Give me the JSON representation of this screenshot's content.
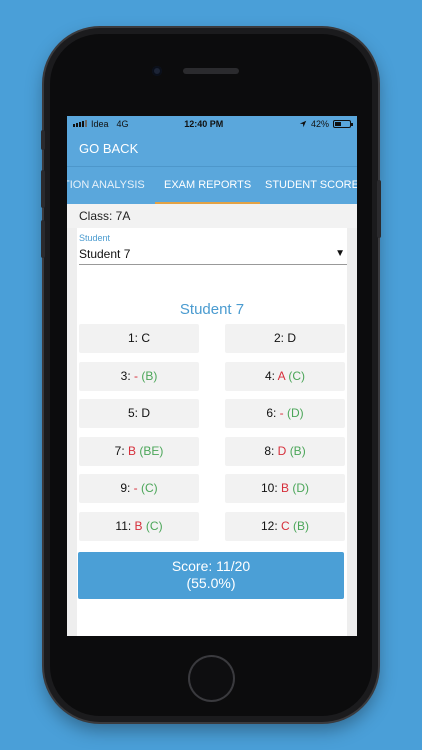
{
  "status_bar": {
    "carrier": "Idea",
    "network": "4G",
    "time": "12:40 PM",
    "battery": "42%",
    "battery_level": 0.42
  },
  "nav": {
    "back_label": "GO BACK"
  },
  "tabs": [
    {
      "label": "TION ANALYSIS"
    },
    {
      "label": "EXAM REPORTS"
    },
    {
      "label": "STUDENT SCORES"
    }
  ],
  "class_label": "Class: 7A",
  "student_field": {
    "label": "Student",
    "value": "Student 7"
  },
  "student_heading": "Student 7",
  "answers": [
    {
      "num": "1:",
      "given": "C",
      "correct": ""
    },
    {
      "num": "2:",
      "given": "D",
      "correct": ""
    },
    {
      "num": "3:",
      "given": "-",
      "correct": "(B)"
    },
    {
      "num": "4:",
      "given": "A",
      "correct": "(C)"
    },
    {
      "num": "5:",
      "given": "D",
      "correct": ""
    },
    {
      "num": "6:",
      "given": "-",
      "correct": "(D)"
    },
    {
      "num": "7:",
      "given": "B",
      "correct": "(BE)"
    },
    {
      "num": "8:",
      "given": "D",
      "correct": "(B)"
    },
    {
      "num": "9:",
      "given": "-",
      "correct": "(C)"
    },
    {
      "num": "10:",
      "given": "B",
      "correct": "(D)"
    },
    {
      "num": "11:",
      "given": "B",
      "correct": "(C)"
    },
    {
      "num": "12:",
      "given": "C",
      "correct": "(B)"
    }
  ],
  "score": {
    "line1": "Score: 11/20",
    "line2": "(55.0%)"
  },
  "colors": {
    "primary": "#5aa7dc",
    "accent_underline": "#e3a245",
    "wrong": "#d62e3a",
    "correct": "#4ba659",
    "background": "#4a9fd8"
  }
}
